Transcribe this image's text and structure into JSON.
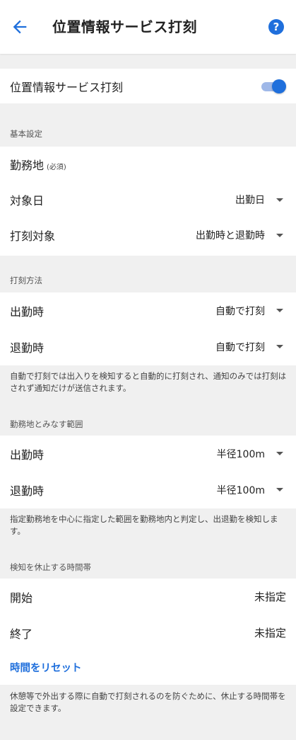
{
  "appbar": {
    "title": "位置情報サービス打刻",
    "help": "?"
  },
  "master": {
    "label": "位置情報サービス打刻",
    "enabled": true,
    "accent": "#1f6fdc"
  },
  "basic": {
    "header": "基本設定",
    "workplace_label": "勤務地",
    "workplace_required": "(必須)",
    "target_day_label": "対象日",
    "target_day_value": "出勤日",
    "stamp_target_label": "打刻対象",
    "stamp_target_value": "出勤時と退勤時"
  },
  "method": {
    "header": "打刻方法",
    "clock_in_label": "出勤時",
    "clock_in_value": "自動で打刻",
    "clock_out_label": "退勤時",
    "clock_out_value": "自動で打刻",
    "note": "自動で打刻では出入りを検知すると自動的に打刻され、通知のみでは打刻はされず通知だけが送信されます。"
  },
  "range": {
    "header": "勤務地とみなす範囲",
    "clock_in_label": "出勤時",
    "clock_in_value": "半径100m",
    "clock_out_label": "退勤時",
    "clock_out_value": "半径100m",
    "note": "指定勤務地を中心に指定した範囲を勤務地内と判定し、出退勤を検知します。"
  },
  "pause": {
    "header": "検知を休止する時間帯",
    "start_label": "開始",
    "start_value": "未指定",
    "end_label": "終了",
    "end_value": "未指定",
    "reset_label": "時間をリセット",
    "note": "休憩等で外出する際に自動で打刻されるのを防ぐために、休止する時間帯を設定できます。"
  }
}
